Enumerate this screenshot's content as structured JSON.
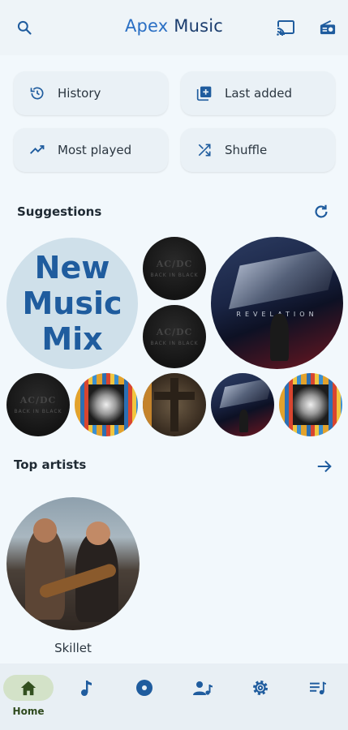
{
  "header": {
    "title_part1": "Apex",
    "title_part2": " Music",
    "icons": [
      "search-icon",
      "cast-icon",
      "radio-icon"
    ]
  },
  "quick_actions": [
    {
      "label": "History",
      "icon": "history-icon"
    },
    {
      "label": "Last added",
      "icon": "library-add-icon"
    },
    {
      "label": "Most played",
      "icon": "trending-up-icon"
    },
    {
      "label": "Shuffle",
      "icon": "shuffle-icon"
    }
  ],
  "suggestions": {
    "title": "Suggestions",
    "mix_label": "New Music Mix"
  },
  "top_artists": {
    "title": "Top artists",
    "artists": [
      {
        "name": "Skillet"
      }
    ]
  },
  "bottom_nav": {
    "items": [
      {
        "label": "Home",
        "icon": "home-icon",
        "active": true
      },
      {
        "label": "",
        "icon": "music-note-icon"
      },
      {
        "label": "",
        "icon": "album-icon"
      },
      {
        "label": "",
        "icon": "artist-icon"
      },
      {
        "label": "",
        "icon": "settings-icon"
      },
      {
        "label": "",
        "icon": "queue-music-icon"
      }
    ]
  },
  "colors": {
    "accent": "#1f5c9e",
    "background": "#f2f8fc",
    "nav_active": "#d3e2c8"
  }
}
